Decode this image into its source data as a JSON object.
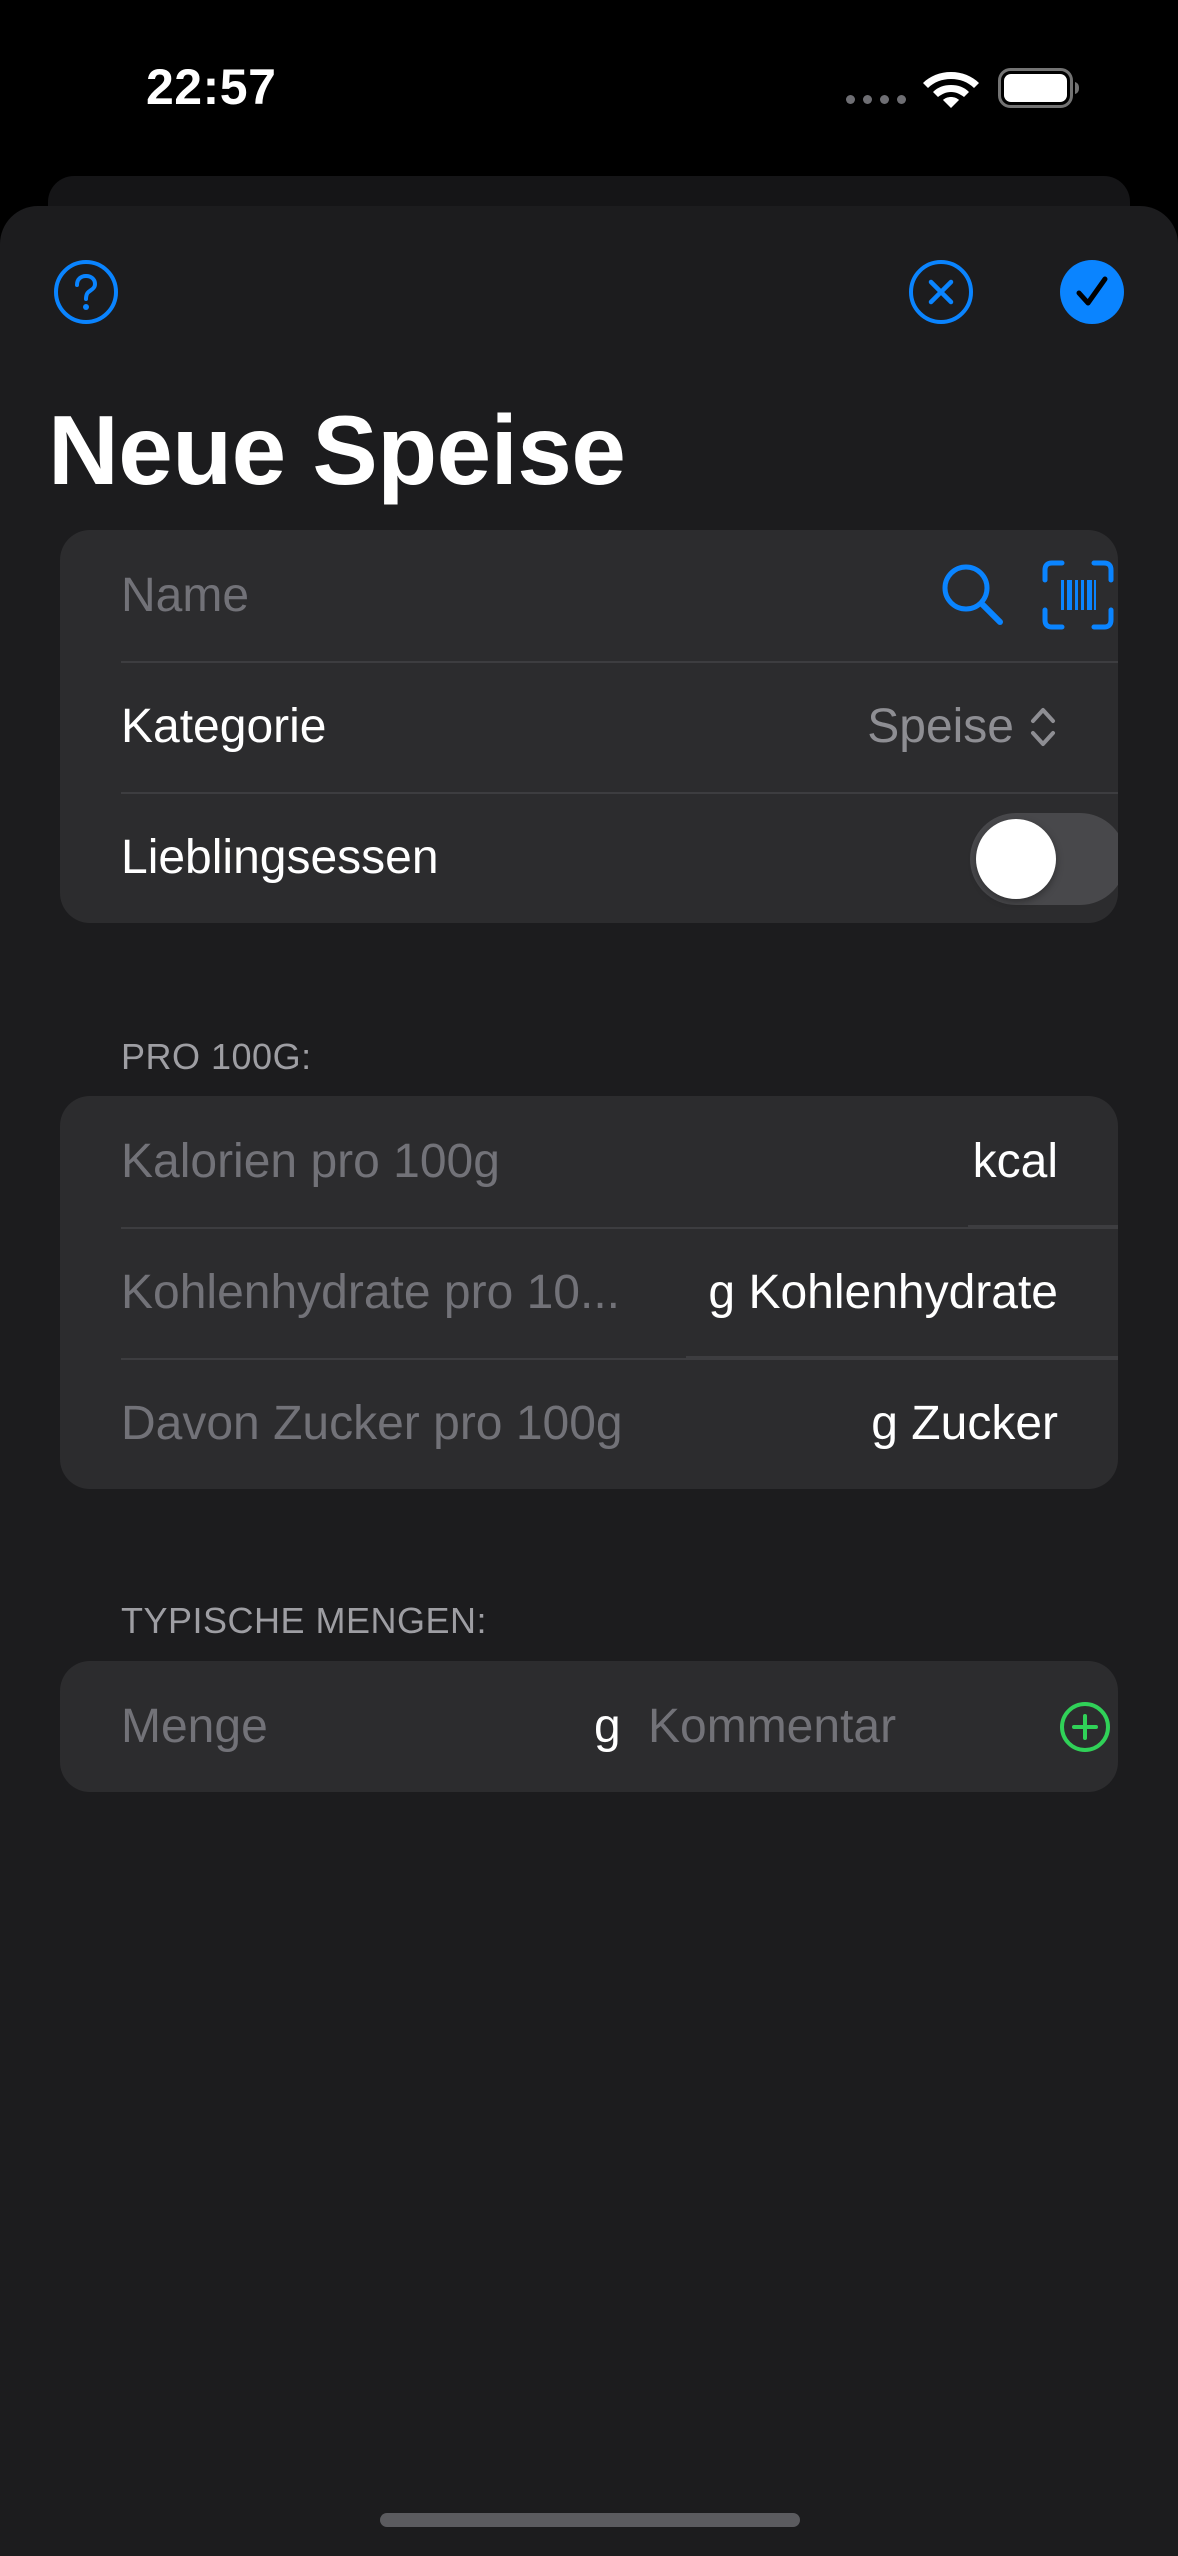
{
  "status_bar": {
    "time": "22:57"
  },
  "nav": {
    "help_icon": "question-circle-icon",
    "close_icon": "xmark-circle-icon",
    "done_icon": "checkmark-circle-fill-icon",
    "title": "Neue Speise"
  },
  "basics": {
    "name_placeholder": "Name",
    "search_icon": "magnifyingglass-icon",
    "barcode_icon": "barcode-viewfinder-icon",
    "category_label": "Kategorie",
    "category_value": "Speise",
    "favorite_label": "Lieblingsessen",
    "favorite_on": false
  },
  "per100": {
    "header": "PRO 100G:",
    "calories_placeholder": "Kalorien pro 100g",
    "calories_unit": "kcal",
    "carbs_placeholder": "Kohlenhydrate pro 10...",
    "carbs_unit": "g Kohlenhydrate",
    "sugar_placeholder": "Davon Zucker pro 100g",
    "sugar_unit": "g Zucker"
  },
  "amounts": {
    "header": "TYPISCHE MENGEN:",
    "amount_placeholder": "Menge",
    "amount_unit": "g",
    "comment_placeholder": "Kommentar",
    "add_icon": "plus-circle-icon"
  },
  "colors": {
    "accent": "#0a84ff",
    "add_green": "#30d158",
    "background": "#1c1c1e",
    "group_background": "#2c2c2e"
  }
}
